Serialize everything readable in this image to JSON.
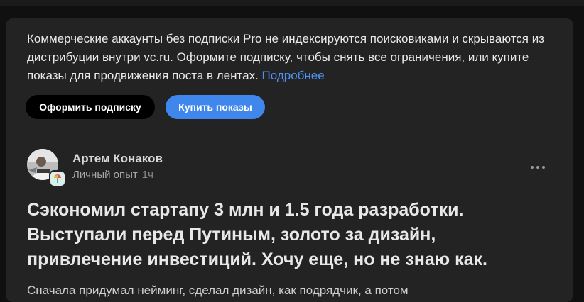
{
  "notice": {
    "text": "Коммерческие аккаунты без подписки Pro не индексируются поисковиками и скрываются из дистрибуции внутри vc.ru. Оформите подписку, чтобы снять все ограничения, или купите показы для продвижения поста в лентах.",
    "more_link": "Подробнее"
  },
  "buttons": {
    "subscribe": "Оформить подписку",
    "buy_views": "Купить показы"
  },
  "post": {
    "author": "Артем Конаков",
    "category": "Личный опыт",
    "time": "1ч",
    "title": "Сэкономил стартапу 3 млн и 1.5 года разработки. Выступали перед Путиным, золото за дизайн, привлечение инвестиций. Хочу еще, но не знаю как.",
    "lead": "Сначала придумал нейминг, сделал дизайн, как подрядчик, а потом"
  },
  "colors": {
    "accent": "#3f87ec",
    "link": "#4c93f5",
    "card_bg": "#232323"
  },
  "icons": {
    "more": "more-horizontal-icon",
    "badge": "author-badge-icon"
  }
}
